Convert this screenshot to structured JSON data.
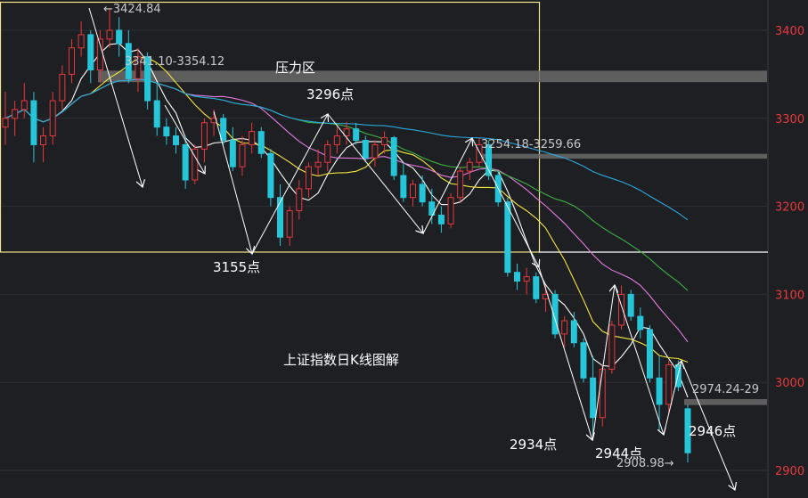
{
  "chart_data": {
    "type": "candlestick",
    "title": "上证指数日K线图解",
    "y_ticks": [
      3400,
      3300,
      3200,
      3100,
      3000,
      2900
    ],
    "ylim": [
      2870,
      3445
    ],
    "colors": {
      "up": "#e8383d",
      "down": "#26c6da",
      "ma5": "#ffffff",
      "ma10": "#f5e63b",
      "ma20": "#e27ae0",
      "ma30": "#3cb043",
      "ma60": "#29a8e0",
      "box": "#f0e68c",
      "resistance_band": "#6a6a6a"
    },
    "candles": [
      [
        3290,
        3330,
        3270,
        3300
      ],
      [
        3300,
        3320,
        3280,
        3310
      ],
      [
        3310,
        3340,
        3300,
        3320
      ],
      [
        3320,
        3330,
        3250,
        3270
      ],
      [
        3270,
        3290,
        3250,
        3280
      ],
      [
        3280,
        3330,
        3270,
        3320
      ],
      [
        3320,
        3360,
        3310,
        3350
      ],
      [
        3350,
        3390,
        3340,
        3380
      ],
      [
        3380,
        3410,
        3370,
        3395
      ],
      [
        3395,
        3400,
        3340,
        3355
      ],
      [
        3355,
        3400,
        3340,
        3390
      ],
      [
        3390,
        3425,
        3380,
        3400
      ],
      [
        3400,
        3415,
        3370,
        3385
      ],
      [
        3385,
        3400,
        3340,
        3345
      ],
      [
        3345,
        3380,
        3330,
        3370
      ],
      [
        3370,
        3375,
        3310,
        3320
      ],
      [
        3320,
        3340,
        3280,
        3290
      ],
      [
        3290,
        3300,
        3270,
        3280
      ],
      [
        3280,
        3290,
        3260,
        3270
      ],
      [
        3270,
        3280,
        3220,
        3230
      ],
      [
        3230,
        3270,
        3225,
        3265
      ],
      [
        3265,
        3300,
        3250,
        3295
      ],
      [
        3295,
        3310,
        3280,
        3300
      ],
      [
        3300,
        3305,
        3270,
        3275
      ],
      [
        3275,
        3290,
        3240,
        3245
      ],
      [
        3245,
        3280,
        3235,
        3270
      ],
      [
        3270,
        3295,
        3260,
        3285
      ],
      [
        3285,
        3290,
        3255,
        3260
      ],
      [
        3260,
        3265,
        3200,
        3210
      ],
      [
        3210,
        3225,
        3155,
        3165
      ],
      [
        3165,
        3200,
        3155,
        3195
      ],
      [
        3195,
        3230,
        3185,
        3220
      ],
      [
        3220,
        3250,
        3210,
        3245
      ],
      [
        3245,
        3265,
        3235,
        3250
      ],
      [
        3250,
        3275,
        3240,
        3270
      ],
      [
        3270,
        3290,
        3260,
        3280
      ],
      [
        3280,
        3296,
        3270,
        3288
      ],
      [
        3288,
        3295,
        3270,
        3275
      ],
      [
        3275,
        3280,
        3250,
        3255
      ],
      [
        3255,
        3275,
        3245,
        3270
      ],
      [
        3270,
        3285,
        3260,
        3278
      ],
      [
        3278,
        3280,
        3230,
        3235
      ],
      [
        3235,
        3250,
        3205,
        3210
      ],
      [
        3210,
        3230,
        3200,
        3225
      ],
      [
        3225,
        3235,
        3200,
        3205
      ],
      [
        3205,
        3220,
        3180,
        3190
      ],
      [
        3190,
        3200,
        3170,
        3180
      ],
      [
        3180,
        3215,
        3175,
        3210
      ],
      [
        3210,
        3245,
        3205,
        3240
      ],
      [
        3240,
        3255,
        3230,
        3250
      ],
      [
        3250,
        3278,
        3245,
        3270
      ],
      [
        3270,
        3275,
        3230,
        3235
      ],
      [
        3235,
        3240,
        3200,
        3205
      ],
      [
        3205,
        3210,
        3120,
        3125
      ],
      [
        3125,
        3135,
        3105,
        3115
      ],
      [
        3115,
        3130,
        3100,
        3120
      ],
      [
        3120,
        3125,
        3090,
        3095
      ],
      [
        3095,
        3110,
        3080,
        3100
      ],
      [
        3100,
        3105,
        3050,
        3055
      ],
      [
        3055,
        3075,
        3040,
        3070
      ],
      [
        3070,
        3080,
        3040,
        3045
      ],
      [
        3045,
        3050,
        3000,
        3005
      ],
      [
        3005,
        3030,
        2934,
        2960
      ],
      [
        2960,
        3020,
        2950,
        3015
      ],
      [
        3015,
        3070,
        3010,
        3065
      ],
      [
        3065,
        3110,
        3060,
        3100
      ],
      [
        3100,
        3105,
        3070,
        3075
      ],
      [
        3075,
        3085,
        3050,
        3060
      ],
      [
        3060,
        3065,
        3000,
        3005
      ],
      [
        3005,
        3030,
        2944,
        2975
      ],
      [
        2975,
        3025,
        2965,
        3020
      ],
      [
        3020,
        3025,
        2990,
        2995
      ],
      [
        2970,
        2975,
        2908.98,
        2920
      ]
    ],
    "annotations": {
      "high": "←3424.84",
      "resistance_upper": "3341.10-3354.12",
      "resistance_zone": "压力区",
      "peak_3296": "3296点",
      "band_mid": "3254.18-3259.66",
      "low_3155": "3155点",
      "low_2934": "2934点",
      "low_2944": "2944点",
      "low_2946": "2946点",
      "low_2908": "2908.98→",
      "band_low": "2974.24-29"
    }
  }
}
